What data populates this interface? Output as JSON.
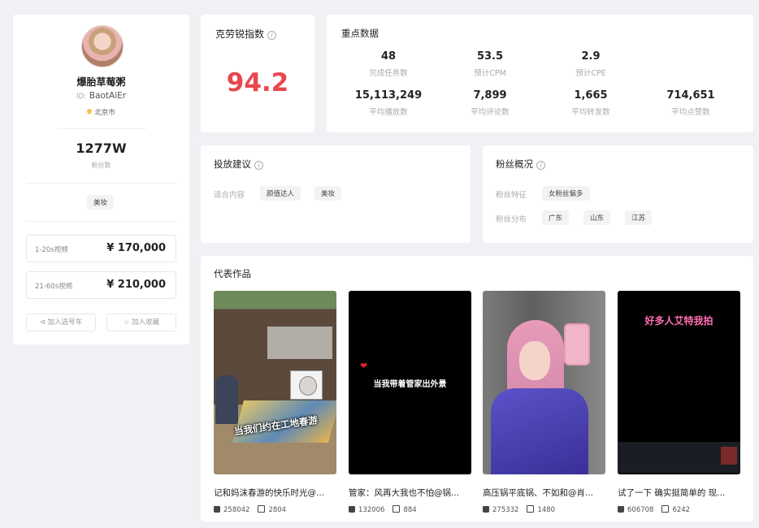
{
  "profile": {
    "name": "爆胎草莓粥",
    "id_label": "ID:",
    "id_value": "BaotAiEr",
    "location": "北京市",
    "fans_value": "1277W",
    "fans_label": "粉丝数",
    "tag": "美妆",
    "prices": [
      {
        "label": "1-20s视频",
        "value": "¥ 170,000"
      },
      {
        "label": "21-60s视频",
        "value": "¥ 210,000"
      }
    ],
    "add_cart_label": "加入选号车",
    "add_fav_label": "加入收藏"
  },
  "index_card": {
    "title": "克劳锐指数",
    "value": "94.2"
  },
  "key_data": {
    "title": "重点数据",
    "row1": [
      {
        "value": "48",
        "label": "完成任务数"
      },
      {
        "value": "53.5",
        "label": "预计CPM"
      },
      {
        "value": "2.9",
        "label": "预计CPE"
      }
    ],
    "row2": [
      {
        "value": "15,113,249",
        "label": "平均播放数"
      },
      {
        "value": "7,899",
        "label": "平均评论数"
      },
      {
        "value": "1,665",
        "label": "平均转发数"
      },
      {
        "value": "714,651",
        "label": "平均点赞数"
      }
    ]
  },
  "suggest": {
    "title": "投放建议",
    "row_label": "适合内容",
    "chips": [
      "颜值达人",
      "美妆"
    ]
  },
  "fans_overview": {
    "title": "粉丝概况",
    "feature_label": "粉丝特征",
    "feature_chip": "女粉丝偏多",
    "region_label": "粉丝分布",
    "regions": [
      "广东",
      "山东",
      "江苏"
    ]
  },
  "works": {
    "title": "代表作品",
    "items": [
      {
        "caption": "当我们约在工地春游",
        "title": "记和妈沫春游的快乐时光@...",
        "likes": "258042",
        "comments": "2804"
      },
      {
        "caption": "当我带着管家出外景",
        "title": "管家：风再大我也不怕@锅...",
        "likes": "132006",
        "comments": "884"
      },
      {
        "caption": "",
        "title": "高压锅平底锅、不如和@肖...",
        "likes": "275332",
        "comments": "1480"
      },
      {
        "caption": "好多人艾特我拍",
        "title": "试了一下 确实挺简单的 现...",
        "likes": "606708",
        "comments": "6242"
      }
    ]
  }
}
